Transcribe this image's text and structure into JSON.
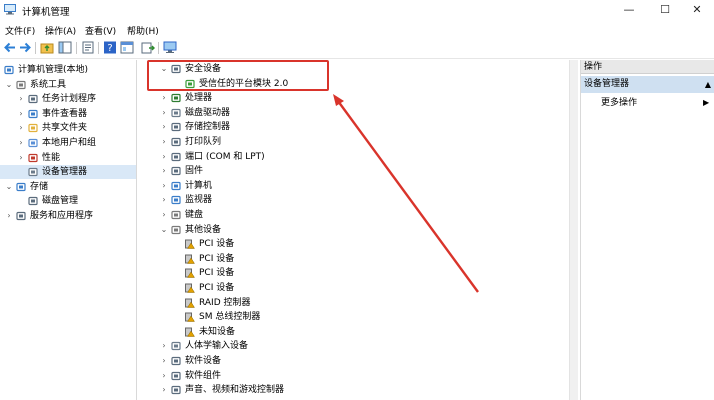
{
  "window": {
    "title": "计算机管理",
    "controls": {
      "minimize": "—",
      "maximize": "☐",
      "close": "✕"
    }
  },
  "menu": [
    "文件(F)",
    "操作(A)",
    "查看(V)",
    "帮助(H)"
  ],
  "left_tree": [
    {
      "label": "计算机管理(本地)",
      "level": 0,
      "chevron": "",
      "icon": "computer-management-icon"
    },
    {
      "label": "系统工具",
      "level": 1,
      "chevron": "⌄",
      "icon": "system-tools-icon"
    },
    {
      "label": "任务计划程序",
      "level": 2,
      "chevron": "›",
      "icon": "task-scheduler-icon"
    },
    {
      "label": "事件查看器",
      "level": 2,
      "chevron": "›",
      "icon": "event-viewer-icon"
    },
    {
      "label": "共享文件夹",
      "level": 2,
      "chevron": "›",
      "icon": "shared-folder-icon"
    },
    {
      "label": "本地用户和组",
      "level": 2,
      "chevron": "›",
      "icon": "users-groups-icon"
    },
    {
      "label": "性能",
      "level": 2,
      "chevron": "›",
      "icon": "performance-icon"
    },
    {
      "label": "设备管理器",
      "level": 2,
      "chevron": "",
      "icon": "device-manager-icon",
      "selected": true
    },
    {
      "label": "存储",
      "level": 1,
      "chevron": "⌄",
      "icon": "storage-icon"
    },
    {
      "label": "磁盘管理",
      "level": 2,
      "chevron": "",
      "icon": "disk-management-icon"
    },
    {
      "label": "服务和应用程序",
      "level": 1,
      "chevron": "›",
      "icon": "services-apps-icon"
    }
  ],
  "device_tree": [
    {
      "label": "安全设备",
      "level": 0,
      "chevron": "⌄",
      "icon": "security-device-icon"
    },
    {
      "label": "受信任的平台模块 2.0",
      "level": 1,
      "chevron": "",
      "icon": "tpm-icon"
    },
    {
      "label": "处理器",
      "level": 0,
      "chevron": "›",
      "icon": "processor-icon"
    },
    {
      "label": "磁盘驱动器",
      "level": 0,
      "chevron": "›",
      "icon": "disk-drive-icon"
    },
    {
      "label": "存储控制器",
      "level": 0,
      "chevron": "›",
      "icon": "storage-controller-icon"
    },
    {
      "label": "打印队列",
      "level": 0,
      "chevron": "›",
      "icon": "print-queue-icon"
    },
    {
      "label": "端口 (COM 和 LPT)",
      "level": 0,
      "chevron": "›",
      "icon": "port-icon"
    },
    {
      "label": "固件",
      "level": 0,
      "chevron": "›",
      "icon": "firmware-icon"
    },
    {
      "label": "计算机",
      "level": 0,
      "chevron": "›",
      "icon": "computer-icon"
    },
    {
      "label": "监视器",
      "level": 0,
      "chevron": "›",
      "icon": "monitor-icon"
    },
    {
      "label": "键盘",
      "level": 0,
      "chevron": "›",
      "icon": "keyboard-icon"
    },
    {
      "label": "其他设备",
      "level": 0,
      "chevron": "⌄",
      "icon": "other-devices-icon"
    },
    {
      "label": "PCI 设备",
      "level": 1,
      "chevron": "",
      "icon": "unknown-device-warning-icon"
    },
    {
      "label": "PCI 设备",
      "level": 1,
      "chevron": "",
      "icon": "unknown-device-warning-icon"
    },
    {
      "label": "PCI 设备",
      "level": 1,
      "chevron": "",
      "icon": "unknown-device-warning-icon"
    },
    {
      "label": "PCI 设备",
      "level": 1,
      "chevron": "",
      "icon": "unknown-device-warning-icon"
    },
    {
      "label": "RAID 控制器",
      "level": 1,
      "chevron": "",
      "icon": "unknown-device-warning-icon"
    },
    {
      "label": "SM 总线控制器",
      "level": 1,
      "chevron": "",
      "icon": "unknown-device-warning-icon"
    },
    {
      "label": "未知设备",
      "level": 1,
      "chevron": "",
      "icon": "unknown-device-warning-icon"
    },
    {
      "label": "人体学输入设备",
      "level": 0,
      "chevron": "›",
      "icon": "hid-icon"
    },
    {
      "label": "软件设备",
      "level": 0,
      "chevron": "›",
      "icon": "software-device-icon"
    },
    {
      "label": "软件组件",
      "level": 0,
      "chevron": "›",
      "icon": "software-component-icon"
    },
    {
      "label": "声音、视频和游戏控制器",
      "level": 0,
      "chevron": "›",
      "icon": "audio-icon"
    }
  ],
  "actions": {
    "header": "操作",
    "section": "设备管理器",
    "section_arrow": "▲",
    "item": "更多操作",
    "item_arrow": "▶"
  },
  "colors": {
    "highlight": "#d9342b",
    "selection": "#d9e8f7",
    "accent": "#2c7fd6"
  }
}
